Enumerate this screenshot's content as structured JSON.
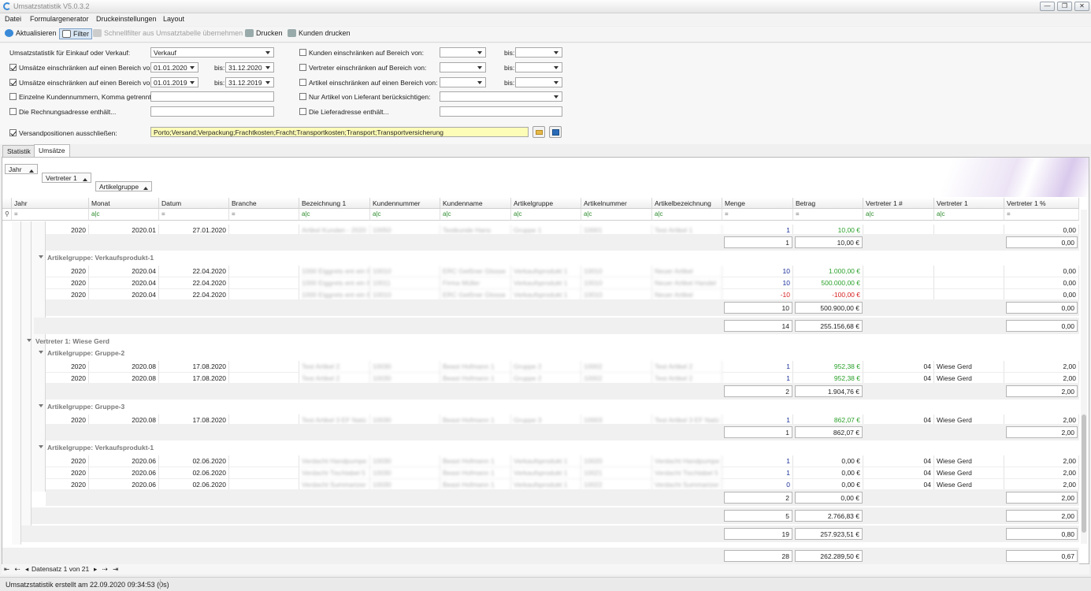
{
  "window": {
    "title": "Umsatzstatistik V5.0.3.2"
  },
  "menu": [
    "Datei",
    "Formulargenerator",
    "Druckeinstellungen",
    "Layout"
  ],
  "toolbar": {
    "refresh": "Aktualisieren",
    "filter": "Filter",
    "quickfilter": "Schnellfilter aus Umsatztabelle übernehmen",
    "print": "Drucken",
    "print_customers": "Kunden drucken"
  },
  "filters": {
    "type_label": "Umsatzstatistik für Einkauf oder Verkauf:",
    "type_value": "Verkauf",
    "range1_label": "Umsätze einschränken auf einen Bereich von:",
    "range1_from": "01.01.2020",
    "range1_to": "31.12.2020",
    "range2_label": "Umsätze einschränken auf einen Bereich von:",
    "range2_from": "01.01.2019",
    "range2_to": "31.12.2019",
    "bis": "bis:",
    "customers_label": "Einzelne Kundennummern, Komma getrennt:",
    "invoice_addr_label": "Die Rechnungsadresse enthält...",
    "shipping_label": "Versandpositionen ausschließen:",
    "shipping_value": "Porto;Versand;Verpackung;Frachtkosten;Fracht;Transportkosten;Transport;Transportversicherung",
    "kunden_label": "Kunden einschränken auf Bereich von:",
    "vertreter_label": "Vertreter einschränken auf Bereich von:",
    "artikel_label": "Artikel einschränken auf einen Bereich von:",
    "lieferant_label": "Nur Artikel von Lieferant berücksichtigen:",
    "lieferadresse_label": "Die Lieferadresse enthält..."
  },
  "tabs": [
    "Statistik",
    "Umsätze"
  ],
  "group_panel": [
    "Jahr",
    "Vertreter 1",
    "Artikelgruppe"
  ],
  "columns": [
    "Jahr",
    "Monat",
    "Datum",
    "Branche",
    "Bezeichnung 1",
    "Kundennummer",
    "Kundenname",
    "Artikelgruppe",
    "Artikelnummer",
    "Artikelbezeichnung",
    "Menge",
    "Betrag",
    "Vertreter 1 #",
    "Vertreter 1",
    "Vertreter 1 %"
  ],
  "filter_row": {
    "eq": "=",
    "contains": "a|c"
  },
  "rows": [
    {
      "jahr": "2020",
      "monat": "2020.01",
      "datum": "27.01.2020",
      "bez": "Artikel Kunden - 2020",
      "kdnr": "10050",
      "kdname": "Testkunde Hans",
      "grp": "Gruppe 1",
      "artnr": "10001",
      "artbez": "Test Artikel 1",
      "menge": "1",
      "betrag": "10,00 €",
      "vnr": "",
      "vname": "",
      "vproz": "0,00"
    },
    {
      "jahr": "2020",
      "monat": "2020.04",
      "datum": "22.04.2020",
      "bez": "1000 Eiggrets ent ein 8",
      "kdnr": "10010",
      "kdname": "ERC Geißner Glosse",
      "grp": "Verkaufsprodukt 1",
      "artnr": "10010",
      "artbez": "Neuer Artikel",
      "menge": "10",
      "betrag": "1.000,00 €",
      "vnr": "",
      "vname": "",
      "vproz": "0,00"
    },
    {
      "jahr": "2020",
      "monat": "2020.04",
      "datum": "22.04.2020",
      "bez": "1000 Eiggrets ent ein 8",
      "kdnr": "10011",
      "kdname": "Firma Müller",
      "grp": "Verkaufsprodukt 1",
      "artnr": "10010",
      "artbez": "Neuer Artikel Handel",
      "menge": "10",
      "betrag": "500.000,00 €",
      "vnr": "",
      "vname": "",
      "vproz": "0,00"
    },
    {
      "jahr": "2020",
      "monat": "2020.04",
      "datum": "22.04.2020",
      "bez": "1000 Eiggrets ent ein 8",
      "kdnr": "10010",
      "kdname": "ERC Geißner Glosse",
      "grp": "Verkaufsprodukt 1",
      "artnr": "10010",
      "artbez": "Neuer Artikel",
      "menge": "-10",
      "betrag": "-100,00 €",
      "vnr": "",
      "vname": "",
      "vproz": "0,00"
    },
    {
      "jahr": "2020",
      "monat": "2020.08",
      "datum": "17.08.2020",
      "bez": "Test Artikel 2",
      "kdnr": "10030",
      "kdname": "Beast Hofmann 1",
      "grp": "Gruppe 2",
      "artnr": "10002",
      "artbez": "Test Artikel 2",
      "menge": "1",
      "betrag": "952,38 €",
      "vnr": "04",
      "vname": "Wiese Gerd",
      "vproz": "2,00"
    },
    {
      "jahr": "2020",
      "monat": "2020.08",
      "datum": "17.08.2020",
      "bez": "Test Artikel 2",
      "kdnr": "10030",
      "kdname": "Beast Hofmann 1",
      "grp": "Gruppe 2",
      "artnr": "10002",
      "artbez": "Test Artikel 2",
      "menge": "1",
      "betrag": "952,38 €",
      "vnr": "04",
      "vname": "Wiese Gerd",
      "vproz": "2,00"
    },
    {
      "jahr": "2020",
      "monat": "2020.08",
      "datum": "17.08.2020",
      "bez": "Test Artikel 3 EF Natü",
      "kdnr": "10030",
      "kdname": "Beast Hofmann 1",
      "grp": "Gruppe 3",
      "artnr": "10003",
      "artbez": "Test Artikel 3 EF Natü",
      "menge": "1",
      "betrag": "862,07 €",
      "vnr": "04",
      "vname": "Wiese Gerd",
      "vproz": "2,00"
    },
    {
      "jahr": "2020",
      "monat": "2020.06",
      "datum": "02.06.2020",
      "bez": "Verdacht Handpumpe",
      "kdnr": "10030",
      "kdname": "Beast Hofmann 1",
      "grp": "Verkaufsprodukt 1",
      "artnr": "10020",
      "artbez": "Verdacht Handpumpe",
      "menge": "1",
      "betrag": "0,00 €",
      "vnr": "04",
      "vname": "Wiese Gerd",
      "vproz": "2,00"
    },
    {
      "jahr": "2020",
      "monat": "2020.06",
      "datum": "02.06.2020",
      "bez": "Verdacht Tischlabel 5",
      "kdnr": "10030",
      "kdname": "Beast Hofmann 1",
      "grp": "Verkaufsprodukt 1",
      "artnr": "10021",
      "artbez": "Verdacht Tischlabel 5",
      "menge": "1",
      "betrag": "0,00 €",
      "vnr": "04",
      "vname": "Wiese Gerd",
      "vproz": "2,00"
    },
    {
      "jahr": "2020",
      "monat": "2020.06",
      "datum": "02.06.2020",
      "bez": "Verdacht Summarizer",
      "kdnr": "10030",
      "kdname": "Beast Hofmann 1",
      "grp": "Verkaufsprodukt 1",
      "artnr": "10022",
      "artbez": "Verdacht Summarizer",
      "menge": "0",
      "betrag": "0,00 €",
      "vnr": "04",
      "vname": "Wiese Gerd",
      "vproz": "2,00"
    }
  ],
  "groups": {
    "g_vk1a": "Artikelgruppe: Verkaufsprodukt-1",
    "g_vertreter": "Vertreter 1: Wiese Gerd",
    "g_gruppe2": "Artikelgruppe: Gruppe-2",
    "g_gruppe3": "Artikelgruppe: Gruppe-3",
    "g_vk1b": "Artikelgruppe: Verkaufsprodukt-1"
  },
  "sums": [
    {
      "menge": "1",
      "betrag": "10,00 €",
      "proz": "0,00"
    },
    {
      "menge": "10",
      "betrag": "500.900,00 €",
      "proz": "0,00"
    },
    {
      "menge": "14",
      "betrag": "255.156,68 €",
      "proz": "0,00"
    },
    {
      "menge": "2",
      "betrag": "1.904,76 €",
      "proz": "2,00"
    },
    {
      "menge": "1",
      "betrag": "862,07 €",
      "proz": "2,00"
    },
    {
      "menge": "2",
      "betrag": "0,00 €",
      "proz": "2,00"
    },
    {
      "menge": "5",
      "betrag": "2.766,83 €",
      "proz": "2,00"
    },
    {
      "menge": "19",
      "betrag": "257.923,51 €",
      "proz": "0,80"
    },
    {
      "menge": "28",
      "betrag": "262.289,50 €",
      "proz": "0,67"
    }
  ],
  "navigator": {
    "record": "Datensatz 1 von 21"
  },
  "status": "Umsatzstatistik erstellt am 22.09.2020 09:34:53 (0s)"
}
